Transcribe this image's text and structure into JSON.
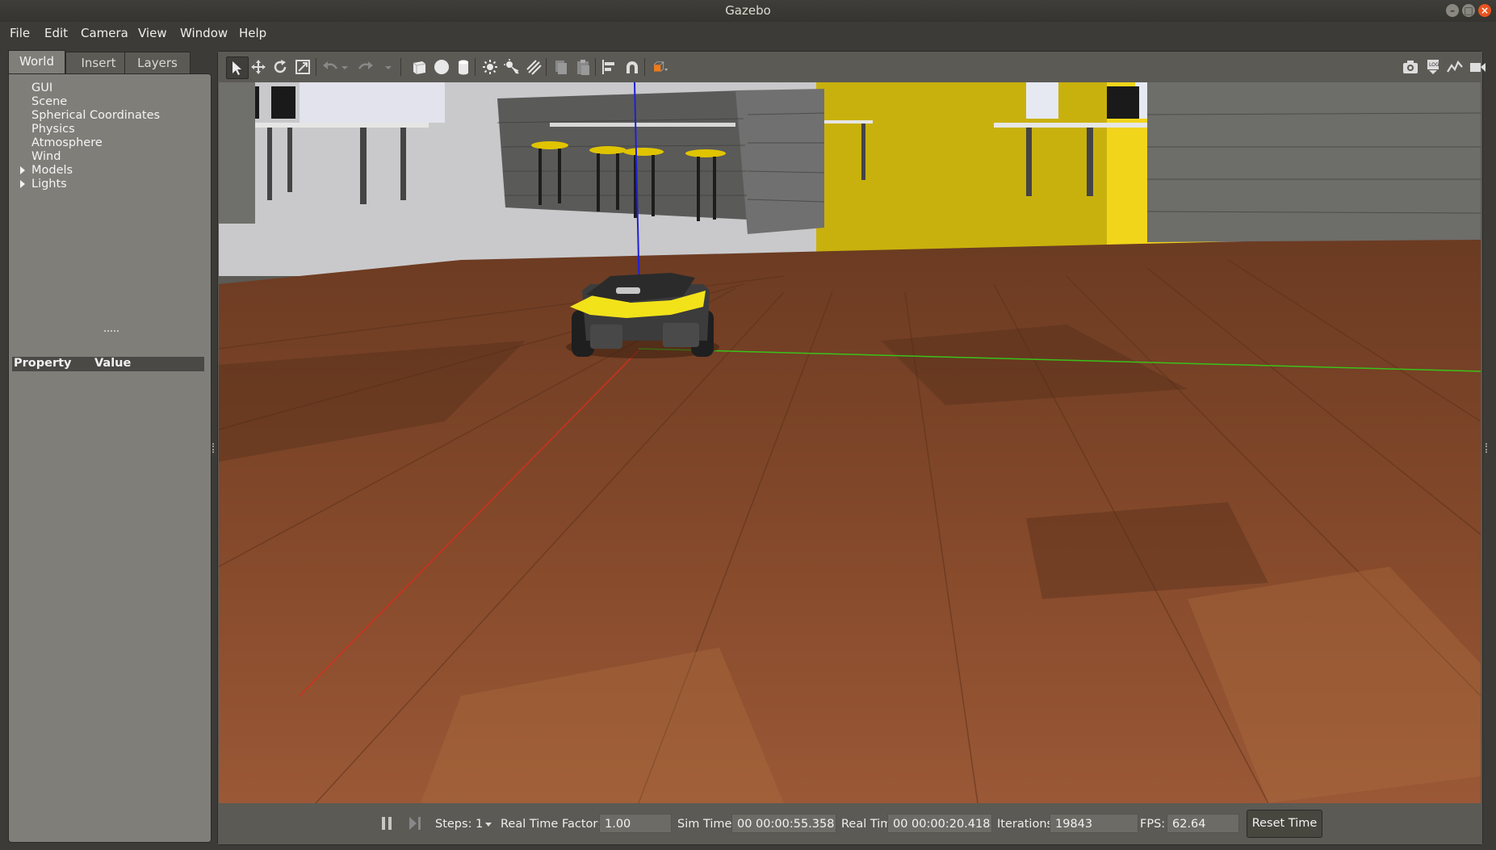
{
  "window": {
    "title": "Gazebo"
  },
  "menubar": {
    "items": [
      "File",
      "Edit",
      "Camera",
      "View",
      "Window",
      "Help"
    ]
  },
  "left_panel": {
    "tabs": [
      "World",
      "Insert",
      "Layers"
    ],
    "active_tab": "World",
    "tree": [
      {
        "label": "GUI",
        "expandable": false
      },
      {
        "label": "Scene",
        "expandable": false
      },
      {
        "label": "Spherical Coordinates",
        "expandable": false
      },
      {
        "label": "Physics",
        "expandable": false
      },
      {
        "label": "Atmosphere",
        "expandable": false
      },
      {
        "label": "Wind",
        "expandable": false
      },
      {
        "label": "Models",
        "expandable": true
      },
      {
        "label": "Lights",
        "expandable": true
      }
    ],
    "property_header": {
      "property": "Property",
      "value": "Value"
    }
  },
  "toolbar": {
    "left_icons": [
      "select-arrow-icon",
      "translate-icon",
      "rotate-icon",
      "scale-icon",
      "undo-icon",
      "undo-history-icon",
      "redo-icon",
      "redo-history-icon",
      "box-icon",
      "sphere-icon",
      "cylinder-icon",
      "point-light-icon",
      "spot-light-icon",
      "directional-light-icon",
      "copy-icon",
      "paste-icon",
      "align-icon",
      "snap-icon",
      "view-angle-icon"
    ],
    "right_icons": [
      "screenshot-icon",
      "log-icon",
      "plot-icon",
      "video-record-icon"
    ],
    "active_tool": "select-arrow-icon"
  },
  "bottom_bar": {
    "steps_label": "Steps:",
    "steps_value": "1",
    "real_time_factor_label": "Real Time Factor:",
    "real_time_factor": "1.00",
    "sim_time_label": "Sim Time:",
    "sim_time": "00 00:00:55.358",
    "real_time_label": "Real Time:",
    "real_time": "00 00:00:20.418",
    "iterations_label": "Iterations:",
    "iterations": "19843",
    "fps_label": "FPS:",
    "fps": "62.64",
    "reset_label": "Reset Time"
  },
  "colors": {
    "accent_yellow": "#f2e21a",
    "floor_wood": "#7a4428",
    "x_axis": "#d0301f",
    "y_axis": "#39c21a",
    "z_axis": "#2020d8",
    "view_angle_orange": "#f07a1a"
  }
}
